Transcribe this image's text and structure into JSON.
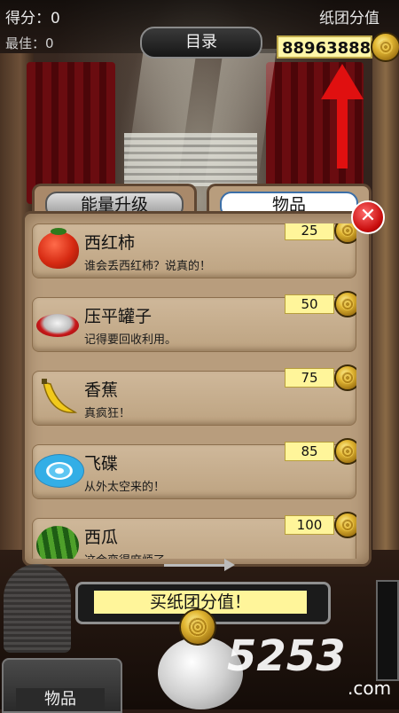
{
  "hud": {
    "score_label": "得分：0",
    "best_label": "最佳：0",
    "value_label": "纸团分值",
    "menu_label": "目录",
    "coins": "88963888"
  },
  "tabs": [
    {
      "label": "能量升级",
      "active": false
    },
    {
      "label": "物品",
      "active": true
    }
  ],
  "close_label": "✕",
  "items": [
    {
      "name": "西红柿",
      "desc": "谁会丢西红柿？说真的！",
      "price": "25",
      "icon": "tomato-icon"
    },
    {
      "name": "压平罐子",
      "desc": "记得要回收利用。",
      "price": "50",
      "icon": "crushed-can-icon"
    },
    {
      "name": "香蕉",
      "desc": "真疯狂！",
      "price": "75",
      "icon": "banana-icon"
    },
    {
      "name": "飞碟",
      "desc": "从外太空来的！",
      "price": "85",
      "icon": "frisbee-icon"
    },
    {
      "name": "西瓜",
      "desc": "这会变得麻烦了。",
      "price": "100",
      "icon": "watermelon-icon"
    }
  ],
  "buy_button": "买纸团分值！",
  "bin_label": "物品",
  "watermark": "5253",
  "watermark_suffix": ".com",
  "colors": {
    "accent_red": "#e01010",
    "price_tag": "#fff59a",
    "panel": "#b89d7d"
  }
}
